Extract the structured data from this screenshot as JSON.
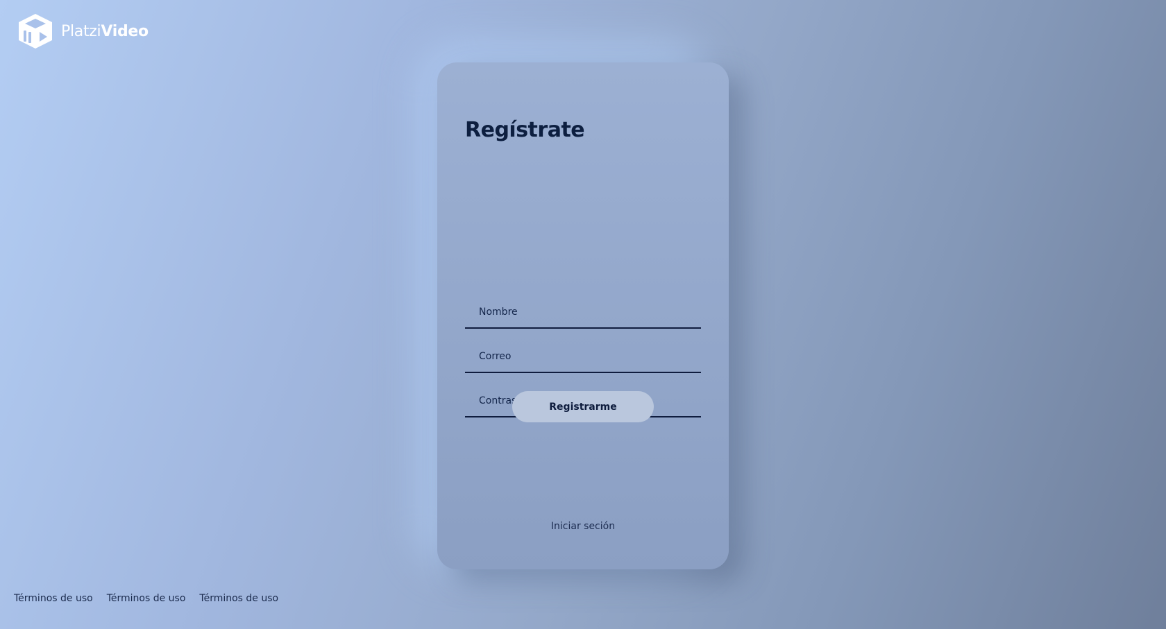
{
  "brand": {
    "name_light": "Platzi",
    "name_bold": "Video",
    "logo_icon": "cube-play-icon"
  },
  "register_card": {
    "title": "Regístrate",
    "fields": {
      "name_placeholder": "Nombre",
      "email_placeholder": "Correo",
      "password_placeholder": "Contraseña"
    },
    "submit_label": "Registrarme",
    "login_link": "Iniciar seción"
  },
  "footer": {
    "links": [
      "Términos de uso",
      "Términos de uso",
      "Términos de uso"
    ]
  },
  "colors": {
    "background_start": "#b3cdf3",
    "background_end": "#6f7f9b",
    "card": "#95a9cc",
    "text_dark": "#0d1f40",
    "button": "#bac7dd"
  }
}
